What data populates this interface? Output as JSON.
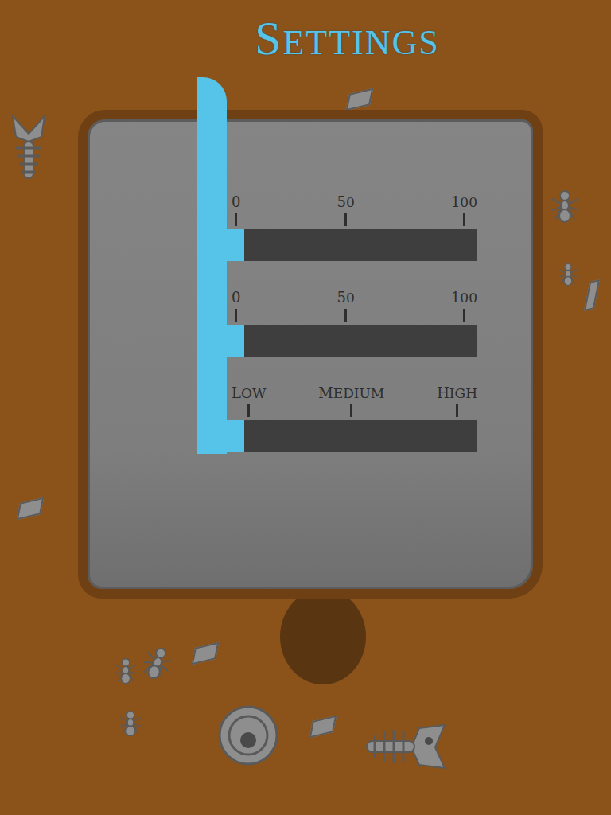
{
  "title": "SETTINGS",
  "sliders": [
    {
      "ticks": [
        "0",
        "50",
        "100"
      ],
      "level": 0
    },
    {
      "ticks": [
        "0",
        "50",
        "100"
      ],
      "level": 0
    },
    {
      "ticks": [
        "LOW",
        "MEDIUM",
        "HIGH"
      ],
      "level": 0
    }
  ]
}
